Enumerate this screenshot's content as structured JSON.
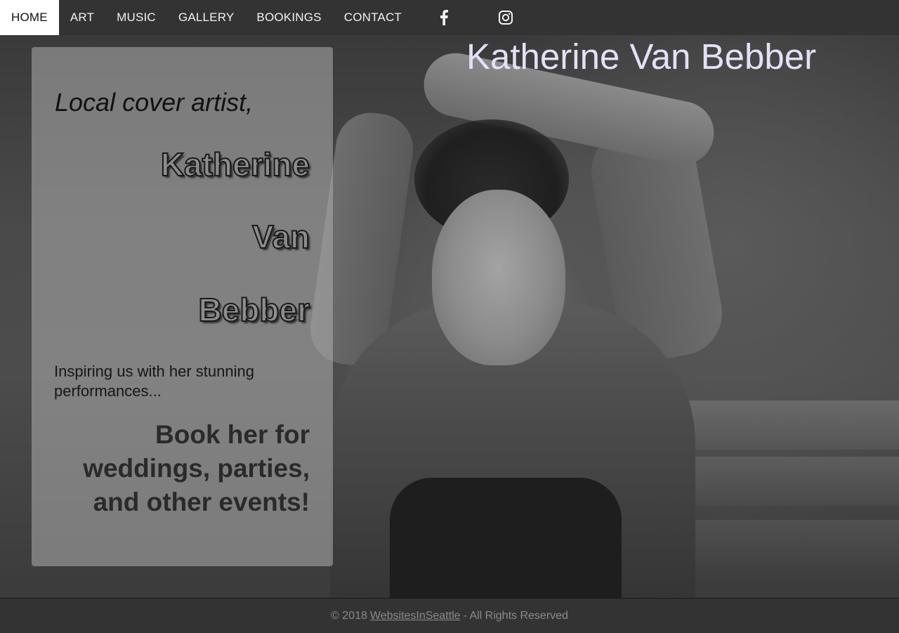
{
  "nav": {
    "items": [
      {
        "label": "HOME",
        "active": true
      },
      {
        "label": "ART",
        "active": false
      },
      {
        "label": "MUSIC",
        "active": false
      },
      {
        "label": "GALLERY",
        "active": false
      },
      {
        "label": "BOOKINGS",
        "active": false
      },
      {
        "label": "CONTACT",
        "active": false
      }
    ],
    "social": [
      {
        "icon": "facebook-icon"
      },
      {
        "icon": "instagram-icon"
      }
    ]
  },
  "hero": {
    "title": "Katherine Van Bebber",
    "title_color": "#e4e0f7"
  },
  "panel": {
    "tagline": "Local cover artist,",
    "name_lines": [
      "Katherine",
      "Van",
      "Bebber"
    ],
    "subtitle": "Inspiring us with her stunning performances...",
    "cta": "Book her for weddings, parties, and other events!"
  },
  "footer": {
    "copyright": "© 2018",
    "link_text": "WebsitesInSeattle",
    "suffix": "- All Rights Reserved"
  },
  "colors": {
    "nav_bg": "#333333",
    "nav_active_bg": "#ffffff",
    "panel_bg": "rgba(175,175,175,0.55)"
  }
}
